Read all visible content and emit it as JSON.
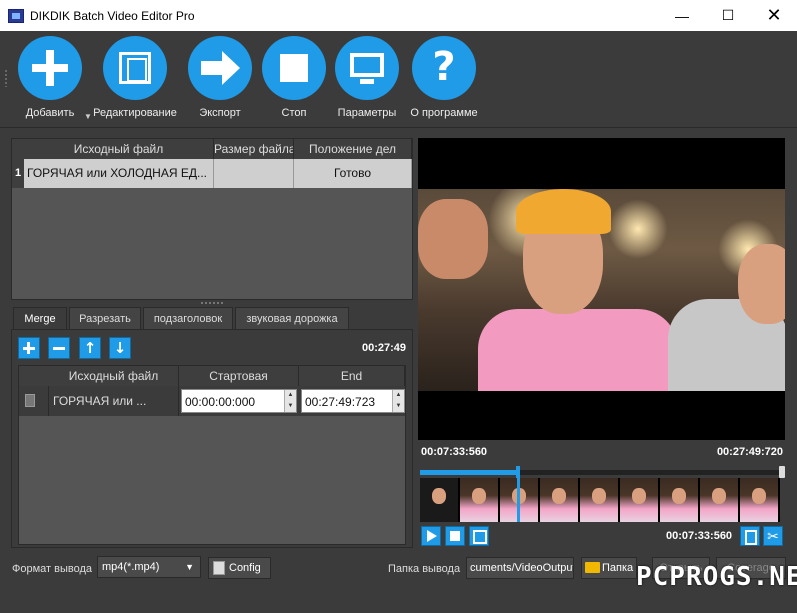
{
  "window": {
    "title": "DIKDIK Batch Video Editor Pro",
    "minimize": "—",
    "maximize": "☐",
    "close": "✕"
  },
  "toolbar": {
    "add_label": "Добавить",
    "edit_label": "Редактирование",
    "export_label": "Экспорт",
    "stop_label": "Стоп",
    "settings_label": "Параметры",
    "about_label": "О программе",
    "add_dropdown": "▼"
  },
  "file_table": {
    "columns": [
      "Исходный файл",
      "Размер файла",
      "Положение дел"
    ],
    "rows": [
      {
        "num": "1",
        "file": "ГОРЯЧАЯ или ХОЛОДНАЯ ЕД...",
        "size": "",
        "status": "Готово"
      }
    ]
  },
  "tabs": [
    "Merge",
    "Разрезать",
    "подзаголовок",
    "звуковая дорожка"
  ],
  "merge": {
    "duration": "00:27:49",
    "columns": [
      "Исходный файл",
      "Стартовая",
      "End"
    ],
    "rows": [
      {
        "file": "ГОРЯЧАЯ или ...",
        "start": "00:00:00:000",
        "end": "00:27:49:723"
      }
    ],
    "up_icon": "↑",
    "down_icon": "↓"
  },
  "player": {
    "current_position": "00:07:33:560",
    "total_duration": "00:27:49:720",
    "cut_position": "00:07:33:560",
    "progress": 0.27,
    "scissors": "✂"
  },
  "bottom": {
    "format_label": "Формат вывода",
    "format_value": "mp4(*.mp4)",
    "format_caret": "▼",
    "config_label": "Config",
    "output_label": "Папка вывода",
    "output_path": "cuments/VideoOutput",
    "folder_label": "Папка",
    "open_label": "Открыть",
    "coverage_label": "Coverage"
  },
  "watermark": "PCPROGS.NET",
  "colors": {
    "accent": "#1f9be8",
    "background": "#3b3b3b"
  }
}
